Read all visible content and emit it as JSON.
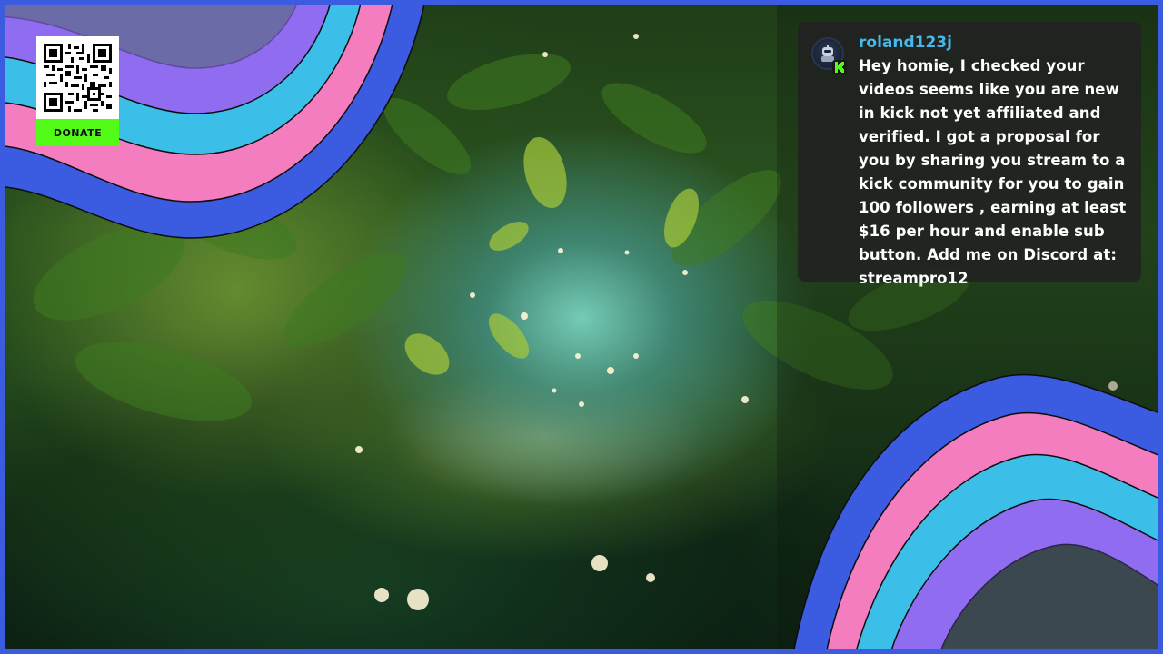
{
  "overlay": {
    "donate_label": "DONATE",
    "qr_icon": "qr-code-icon",
    "colors": {
      "frame": "#3b5be0",
      "wave_blue": "#3b5be0",
      "wave_pink": "#f47dc0",
      "wave_cyan": "#3bbfe8",
      "wave_purple": "#8f6cf0",
      "donate_green": "#53fc18"
    }
  },
  "chat": {
    "username": "roland123j",
    "username_color": "#45b8ec",
    "avatar_icon": "robot-avatar-icon",
    "badge_icon": "kick-logo-icon",
    "message": "Hey homie, I checked your videos seems like you are new in kick not yet affiliated and verified. I got a proposal for you by sharing you stream to a kick community for you to gain 100 followers , earning at least $16 per hour and enable sub button. Add me on Discord at: streampro12"
  }
}
